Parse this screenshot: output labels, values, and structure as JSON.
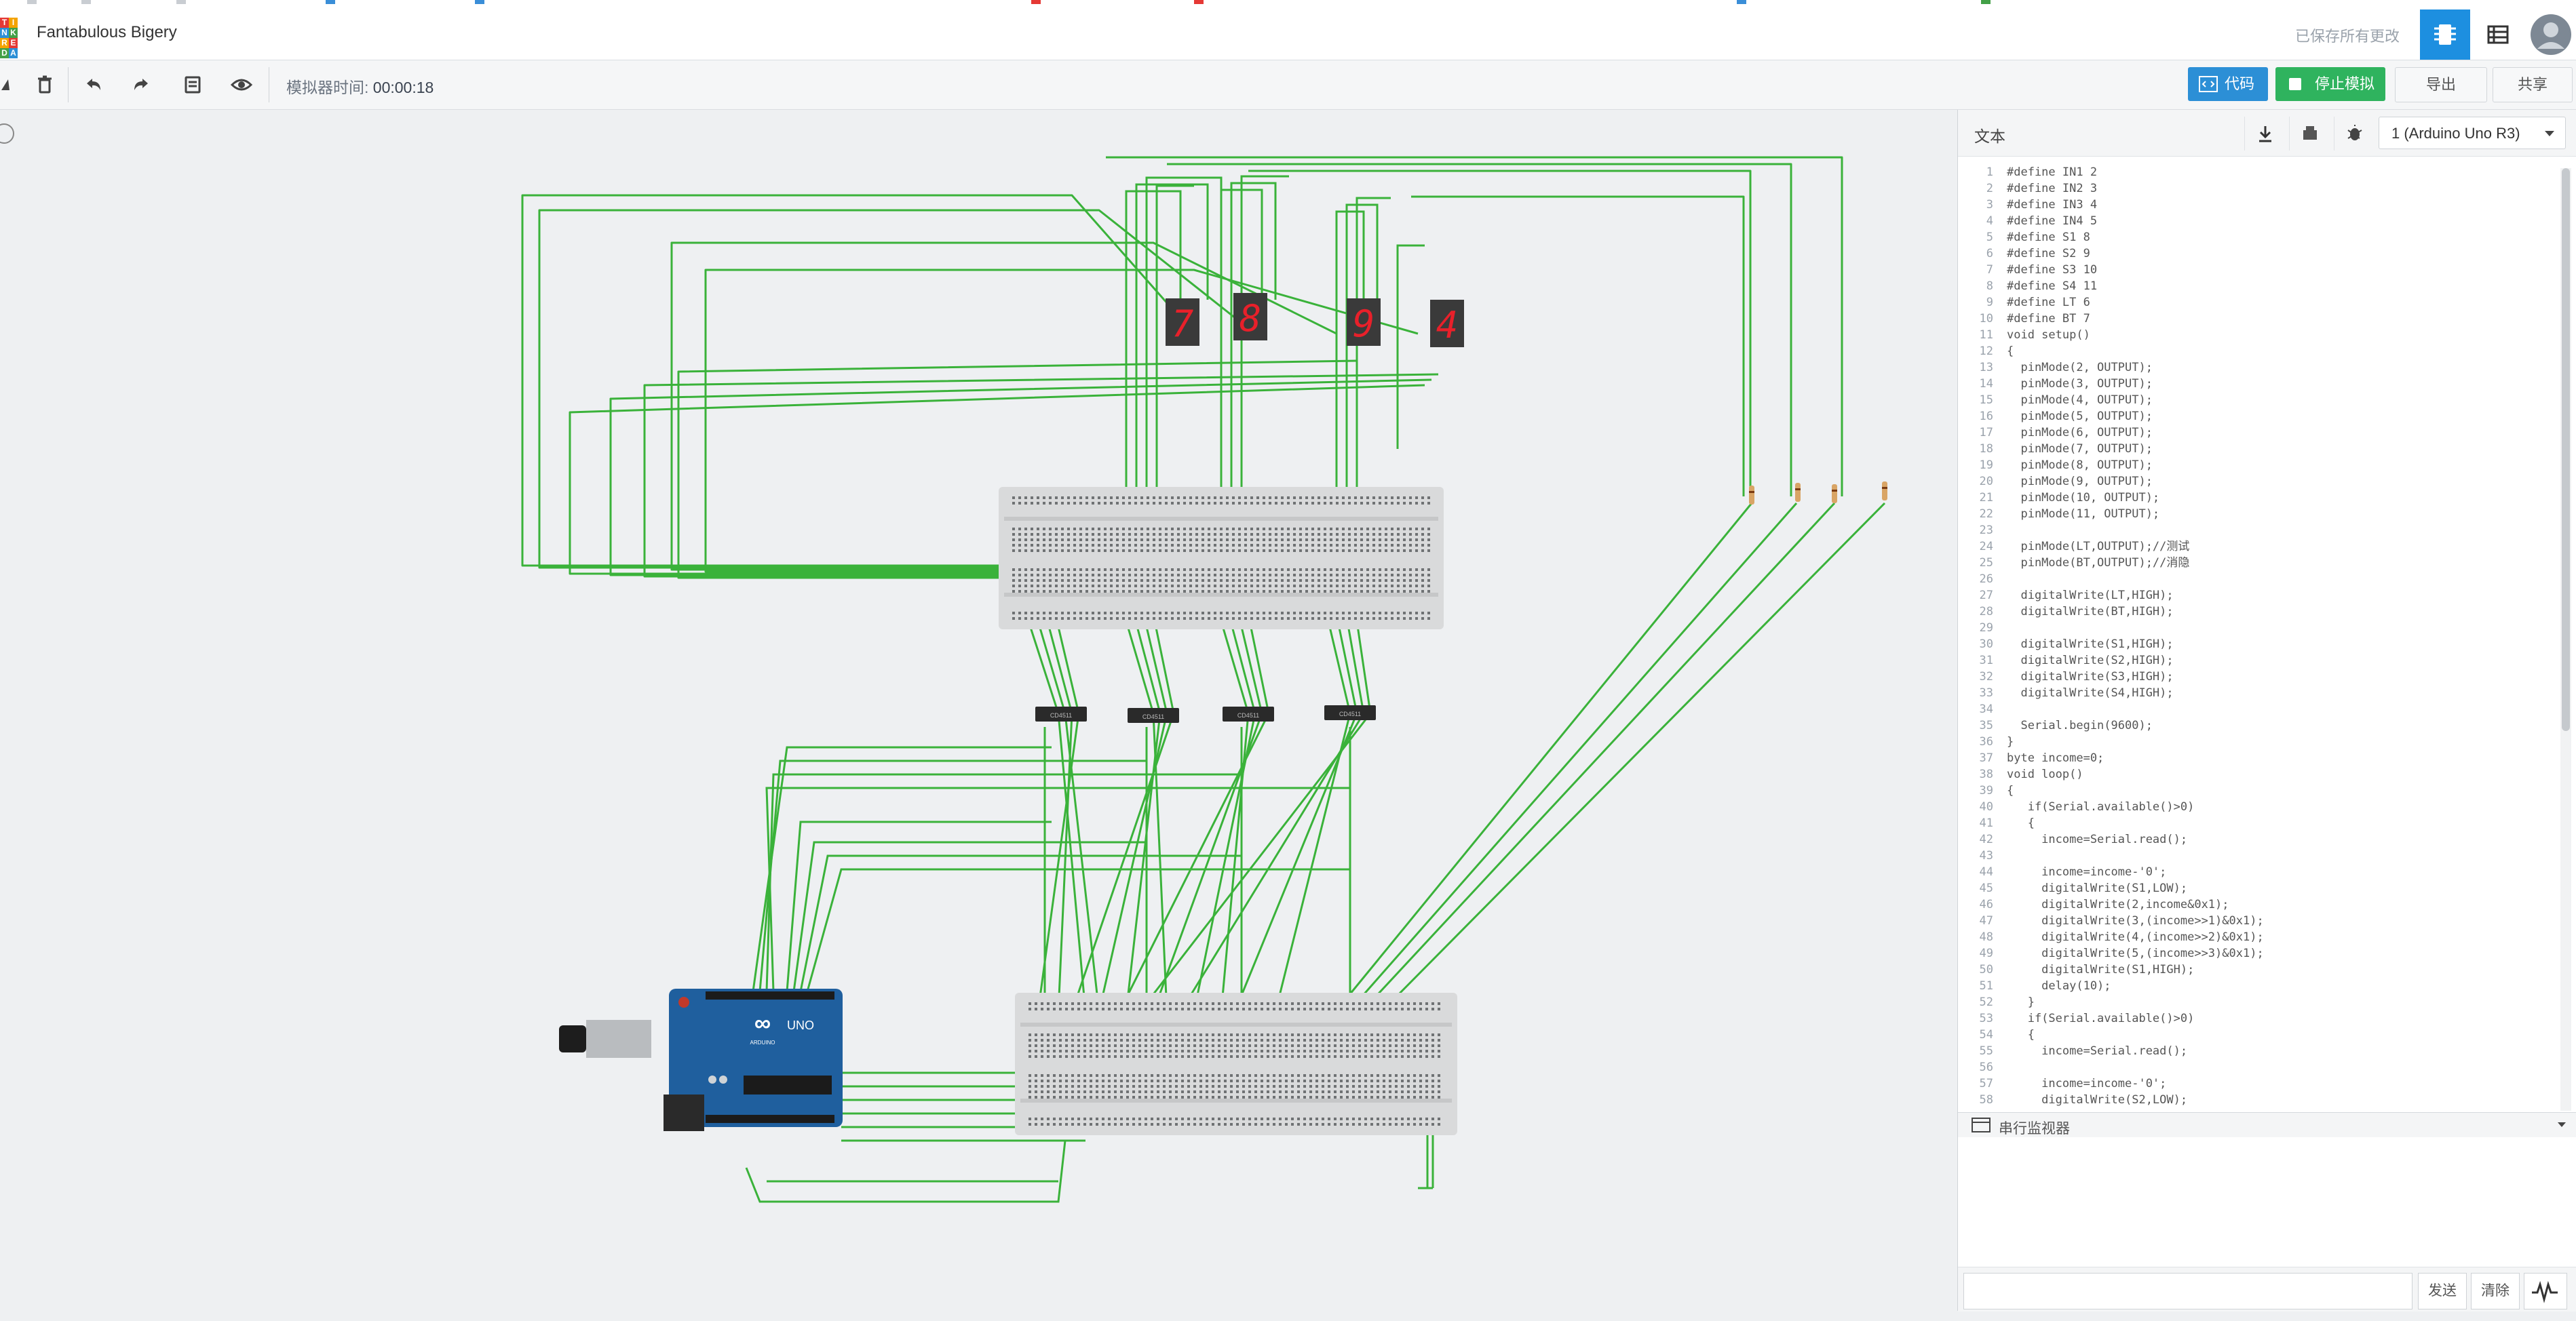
{
  "header": {
    "logo_letters": [
      "T",
      "I",
      "N",
      "K",
      "E",
      "R",
      "C",
      "A",
      "D"
    ],
    "project_title": "Fantabulous Bigery",
    "save_status": "已保存所有更改"
  },
  "toolbar": {
    "sim_time_label": "模拟器时间:",
    "sim_time_value": "00:00:18",
    "code_button": "代码",
    "stop_button": "停止模拟",
    "export_button": "导出",
    "share_button": "共享"
  },
  "code_panel": {
    "mode_label": "文本",
    "board_select": "1 (Arduino Uno R3)",
    "lines": [
      {
        "n": "1",
        "t": "#define IN1 2"
      },
      {
        "n": "2",
        "t": "#define IN2 3"
      },
      {
        "n": "3",
        "t": "#define IN3 4"
      },
      {
        "n": "4",
        "t": "#define IN4 5"
      },
      {
        "n": "5",
        "t": "#define S1 8"
      },
      {
        "n": "6",
        "t": "#define S2 9"
      },
      {
        "n": "7",
        "t": "#define S3 10"
      },
      {
        "n": "8",
        "t": "#define S4 11"
      },
      {
        "n": "9",
        "t": "#define LT 6"
      },
      {
        "n": "10",
        "t": "#define BT 7"
      },
      {
        "n": "11",
        "t": "void setup()"
      },
      {
        "n": "12",
        "t": "{"
      },
      {
        "n": "13",
        "t": "  pinMode(2, OUTPUT);"
      },
      {
        "n": "14",
        "t": "  pinMode(3, OUTPUT);"
      },
      {
        "n": "15",
        "t": "  pinMode(4, OUTPUT);"
      },
      {
        "n": "16",
        "t": "  pinMode(5, OUTPUT);"
      },
      {
        "n": "17",
        "t": "  pinMode(6, OUTPUT);"
      },
      {
        "n": "18",
        "t": "  pinMode(7, OUTPUT);"
      },
      {
        "n": "19",
        "t": "  pinMode(8, OUTPUT);"
      },
      {
        "n": "20",
        "t": "  pinMode(9, OUTPUT);"
      },
      {
        "n": "21",
        "t": "  pinMode(10, OUTPUT);"
      },
      {
        "n": "22",
        "t": "  pinMode(11, OUTPUT);"
      },
      {
        "n": "23",
        "t": ""
      },
      {
        "n": "24",
        "t": "  pinMode(LT,OUTPUT);//测试"
      },
      {
        "n": "25",
        "t": "  pinMode(BT,OUTPUT);//消隐"
      },
      {
        "n": "26",
        "t": ""
      },
      {
        "n": "27",
        "t": "  digitalWrite(LT,HIGH);"
      },
      {
        "n": "28",
        "t": "  digitalWrite(BT,HIGH);"
      },
      {
        "n": "29",
        "t": ""
      },
      {
        "n": "30",
        "t": "  digitalWrite(S1,HIGH);"
      },
      {
        "n": "31",
        "t": "  digitalWrite(S2,HIGH);"
      },
      {
        "n": "32",
        "t": "  digitalWrite(S3,HIGH);"
      },
      {
        "n": "33",
        "t": "  digitalWrite(S4,HIGH);"
      },
      {
        "n": "34",
        "t": ""
      },
      {
        "n": "35",
        "t": "  Serial.begin(9600);"
      },
      {
        "n": "36",
        "t": "}"
      },
      {
        "n": "37",
        "t": "byte income=0;"
      },
      {
        "n": "38",
        "t": "void loop()"
      },
      {
        "n": "39",
        "t": "{"
      },
      {
        "n": "40",
        "t": "   if(Serial.available()>0)"
      },
      {
        "n": "41",
        "t": "   {"
      },
      {
        "n": "42",
        "t": "     income=Serial.read();"
      },
      {
        "n": "43",
        "t": ""
      },
      {
        "n": "44",
        "t": "     income=income-'0';"
      },
      {
        "n": "45",
        "t": "     digitalWrite(S1,LOW);"
      },
      {
        "n": "46",
        "t": "     digitalWrite(2,income&0x1);"
      },
      {
        "n": "47",
        "t": "     digitalWrite(3,(income>>1)&0x1);"
      },
      {
        "n": "48",
        "t": "     digitalWrite(4,(income>>2)&0x1);"
      },
      {
        "n": "49",
        "t": "     digitalWrite(5,(income>>3)&0x1);"
      },
      {
        "n": "50",
        "t": "     digitalWrite(S1,HIGH);"
      },
      {
        "n": "51",
        "t": "     delay(10);"
      },
      {
        "n": "52",
        "t": "   }"
      },
      {
        "n": "53",
        "t": "   if(Serial.available()>0)"
      },
      {
        "n": "54",
        "t": "   {"
      },
      {
        "n": "55",
        "t": "     income=Serial.read();"
      },
      {
        "n": "56",
        "t": ""
      },
      {
        "n": "57",
        "t": "     income=income-'0';"
      },
      {
        "n": "58",
        "t": "     digitalWrite(S2,LOW);"
      }
    ]
  },
  "serial_monitor": {
    "title": "串行监视器",
    "send_button": "发送",
    "clear_button": "清除"
  },
  "circuit": {
    "digit_values": [
      "7",
      "8",
      "9",
      "4"
    ],
    "chip_labels": [
      "CD4511",
      "CD4511",
      "CD4511",
      "CD4511"
    ],
    "board_label": "UNO",
    "board_brand": "ARDUINO"
  },
  "colors": {
    "accent_blue": "#2c8fd6",
    "stop_green": "#2fb35e",
    "wire_green": "#3ab23a",
    "segment_red": "#e8202a",
    "board_blue": "#1f5f9e"
  },
  "icons": [
    "undo-icon",
    "redo-icon",
    "delete-icon",
    "notes-icon",
    "eye-icon",
    "download-icon",
    "print-icon",
    "debug-icon",
    "chip-icon",
    "list-icon",
    "avatar",
    "serial-graph-icon"
  ]
}
